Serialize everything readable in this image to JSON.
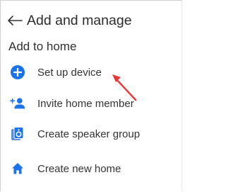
{
  "header": {
    "back_icon": "arrow-left-icon",
    "title": "Add and manage"
  },
  "section": {
    "title": "Add to home"
  },
  "menu": {
    "items": [
      {
        "label": "Set up device",
        "icon": "plus-circle-icon"
      },
      {
        "label": "Invite home member",
        "icon": "add-person-icon"
      },
      {
        "label": "Create speaker group",
        "icon": "speaker-icon"
      },
      {
        "label": "Create new home",
        "icon": "home-icon"
      }
    ]
  },
  "colors": {
    "accent": "#1a73e8",
    "annotation_arrow": "#e53935",
    "text": "#333333"
  }
}
